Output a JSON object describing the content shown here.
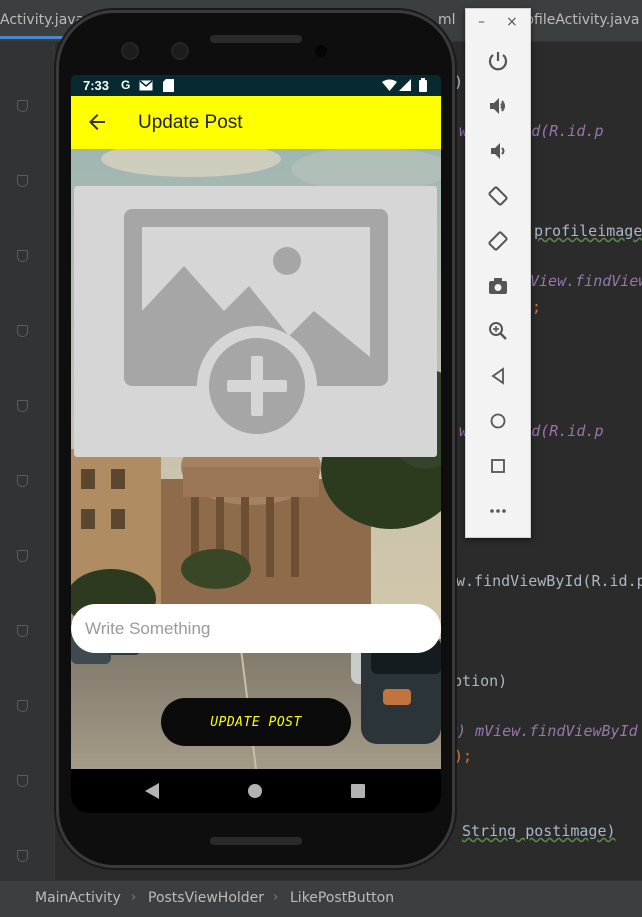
{
  "ide": {
    "tabs": [
      {
        "label": "Activity.java"
      },
      {
        "label": "ml"
      },
      {
        "label": "rofileActivity.java"
      }
    ],
    "code_lines": [
      {
        "text": ")"
      },
      {
        "text": "wViewById(R.id.p"
      },
      {
        "text": "profileimage"
      },
      {
        "text": "View.findView"
      },
      {
        "text": ";"
      },
      {
        "text": "wViewById(R.id.p"
      },
      {
        "text": "w.findViewById(R.id.p"
      },
      {
        "text": "iption)"
      },
      {
        "text": "w) mView.findViewById"
      },
      {
        "text": ");"
      },
      {
        "text": "String postimage)"
      }
    ],
    "breadcrumbs": [
      "MainActivity",
      "PostsViewHolder",
      "LikePostButton"
    ]
  },
  "phone": {
    "status": {
      "time": "7:33",
      "icons": [
        "google-icon",
        "mail-icon",
        "sd-card-icon",
        "wifi-icon",
        "signal-icon",
        "battery-icon"
      ]
    },
    "appbar": {
      "title": "Update Post",
      "color": "#FFFF00"
    },
    "image_picker": {
      "icon": "add-image-icon"
    },
    "description": {
      "placeholder": "Write Something"
    },
    "update_button": {
      "label": "UPDATE POST"
    }
  },
  "emulator_panel": {
    "window": {
      "minimize": "–",
      "close": "×"
    },
    "buttons": [
      "power-icon",
      "volume-up-icon",
      "volume-down-icon",
      "rotate-left-icon",
      "rotate-right-icon",
      "camera-icon",
      "zoom-icon",
      "back-icon",
      "home-icon",
      "overview-icon",
      "more-icon"
    ]
  }
}
